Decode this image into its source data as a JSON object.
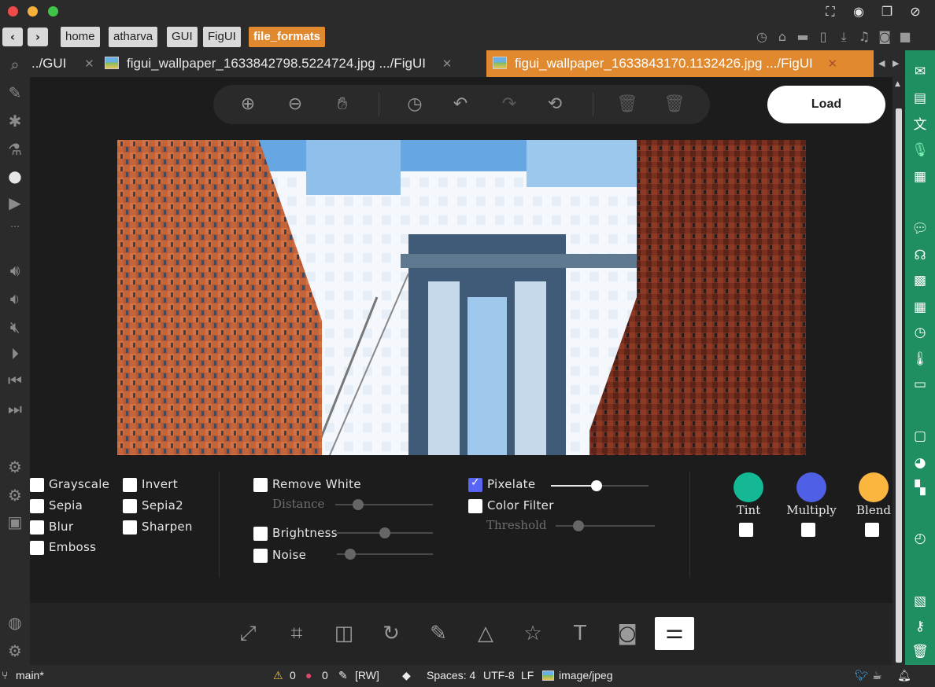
{
  "breadcrumb": {
    "items": [
      "home",
      "atharva",
      "GUI",
      "FigUI",
      "file_formats"
    ]
  },
  "tabs": [
    {
      "label": "../GUI"
    },
    {
      "label": "figui_wallpaper_1633842798.5224724.jpg .../FigUI"
    },
    {
      "label": "figui_wallpaper_1633843170.1132426.jpg .../FigUI"
    }
  ],
  "toolbar": {
    "load_label": "Load"
  },
  "filters": {
    "col1": [
      "Grayscale",
      "Sepia",
      "Blur",
      "Emboss"
    ],
    "col2": [
      "Invert",
      "Sepia2",
      "Sharpen"
    ],
    "remove_white": "Remove White",
    "distance": "Distance",
    "brightness": "Brightness",
    "noise": "Noise",
    "pixelate": "Pixelate",
    "pixelate_level": 0.47,
    "color_filter": "Color Filter",
    "threshold": "Threshold",
    "blends": [
      {
        "label": "Tint",
        "color": "#14b894"
      },
      {
        "label": "Multiply",
        "color": "#5060e6"
      },
      {
        "label": "Blend",
        "color": "#fbb640"
      }
    ]
  },
  "status": {
    "branch": "main*",
    "warnings": "0",
    "errors": "0",
    "mode": "[RW]",
    "spaces": "Spaces: 4",
    "encoding": "UTF-8",
    "eol": "LF",
    "mime": "image/jpeg"
  },
  "colors": {
    "accent": "#e0892f",
    "green_bar": "#1f8f62",
    "checkbox_checked": "#5865f2"
  }
}
